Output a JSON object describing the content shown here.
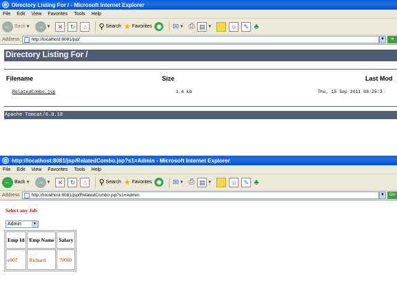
{
  "window1": {
    "title": "Directory Listing For / - Microsoft Internet Explorer",
    "menu": [
      "File",
      "Edit",
      "View",
      "Favorites",
      "Tools",
      "Help"
    ],
    "toolbar": {
      "back_label": "Back",
      "search_label": "Search",
      "favorites_label": "Favorites"
    },
    "address": {
      "label": "Address",
      "url": "http://localhost:8081/jsp/"
    },
    "page": {
      "heading": "Directory Listing For /",
      "columns": {
        "filename": "Filename",
        "size": "Size",
        "last_modified": "Last Mod"
      },
      "row": {
        "filename": "RelatedCombo.jsp",
        "size": "1.4 kb",
        "last_modified": "Thu, 15 Sep 2011 08:25:3"
      },
      "footer": "Apache Tomcat/6.0.18"
    }
  },
  "window2": {
    "title": "http://localhost:8081/jsp/RelatedCombo.jsp?s1=Admin - Microsoft Internet Explorer",
    "menu": [
      "File",
      "Edit",
      "View",
      "Favorites",
      "Tools",
      "Help"
    ],
    "toolbar": {
      "back_label": "Back",
      "search_label": "Search",
      "favorites_label": "Favorites"
    },
    "address": {
      "label": "Address",
      "url": "http://localhost:8081/jsp/RelatedCombo.jsp?s1=Admin",
      "go_label": "Go"
    },
    "page": {
      "heading": "Select any Job",
      "select_value": "Admin",
      "table": {
        "headers": [
          "Emp Id",
          "Emp Name",
          "Salary"
        ],
        "row": [
          "e007",
          "Richard",
          "70000"
        ]
      }
    }
  },
  "colors": {
    "title_bar": "#0a5fd9",
    "tomcat_header": "#525d76",
    "select_heading": "#ff0000",
    "table_text": "#8b4513"
  },
  "icons": [
    "ie-icon",
    "back-icon",
    "forward-icon",
    "stop-icon",
    "refresh-icon",
    "home-icon",
    "search-icon",
    "favorites-icon",
    "media-icon",
    "mail-icon",
    "print-icon",
    "edit-icon",
    "folder-icon",
    "messenger-icon",
    "research-icon",
    "page-icon",
    "go-icon"
  ]
}
